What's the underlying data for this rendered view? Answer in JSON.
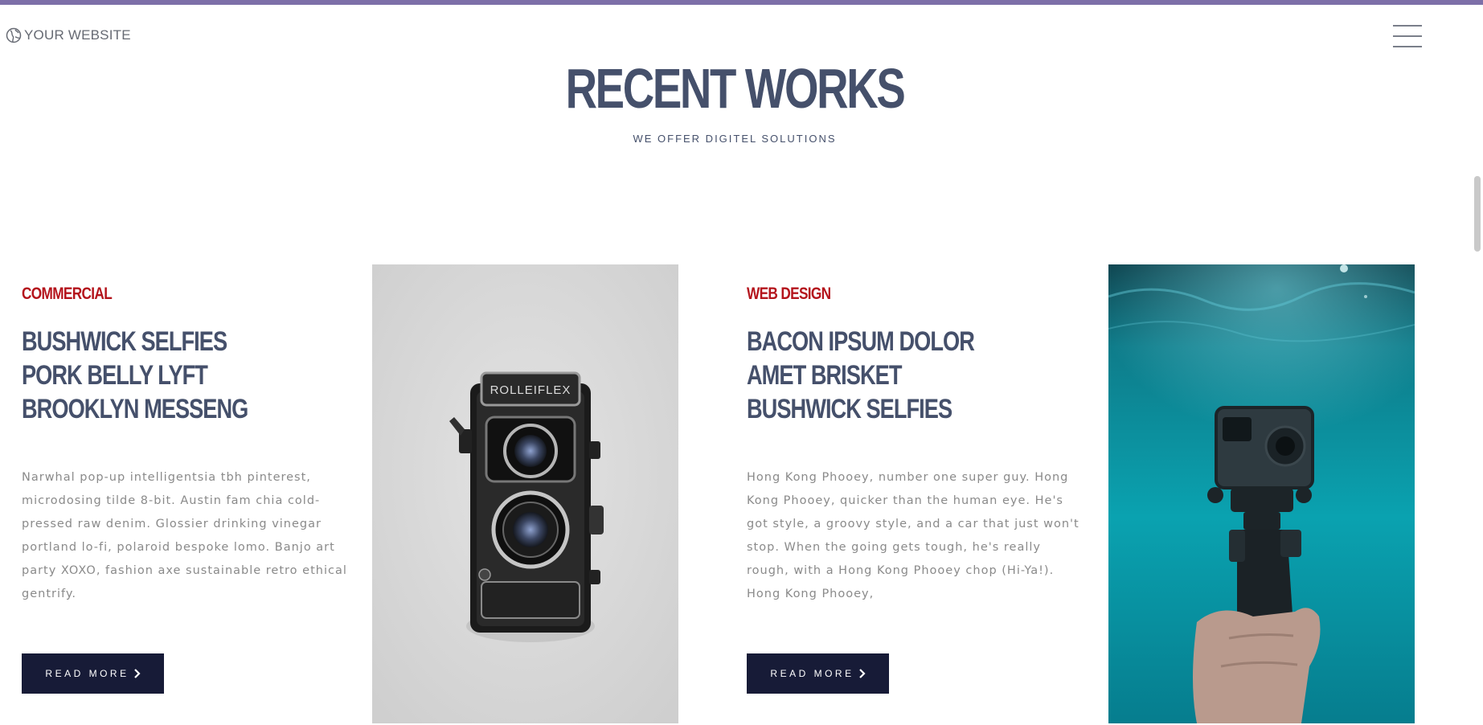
{
  "header": {
    "logo_text": "YOUR WEBSITE",
    "logo_icon": "globe-icon",
    "menu_icon": "hamburger-menu-icon"
  },
  "section": {
    "title": "RECENT WORKS",
    "subtitle": "WE OFFER DIGITEL SOLUTIONS"
  },
  "works": [
    {
      "category": "COMMERCIAL",
      "title_lines": [
        "BUSHWICK SELFIES",
        "PORK BELLY LYFT",
        "BROOKLYN MESSENG"
      ],
      "description": "Narwhal pop-up intelligentsia tbh pinterest, microdosing tilde 8-bit. Austin fam chia cold-pressed raw denim. Glossier drinking vinegar portland lo-fi, polaroid bespoke lomo. Banjo art party XOXO, fashion axe sustainable retro ethical gentrify.",
      "button_label": "READ MORE",
      "image_label": "ROLLEIFLEX"
    },
    {
      "category": "WEB DESIGN",
      "title_lines": [
        "BACON IPSUM DOLOR",
        "AMET BRISKET",
        "BUSHWICK SELFIES"
      ],
      "description": "Hong Kong Phooey, number one super guy. Hong Kong Phooey, quicker than the human eye. He's got style, a groovy style, and a car that just won't stop. When the going gets tough, he's really rough, with a Hong Kong Phooey chop (Hi-Ya!). Hong Kong Phooey,",
      "button_label": "READ MORE"
    }
  ],
  "colors": {
    "accent_top_bar": "#7d6fa8",
    "heading": "#45506b",
    "category": "#b4141c",
    "button_bg": "#171b37",
    "body_text": "#8a8a8a"
  }
}
